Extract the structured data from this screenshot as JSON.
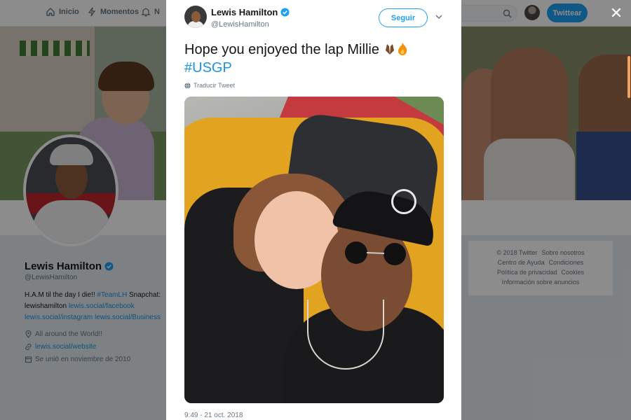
{
  "nav": {
    "home_label": "Inicio",
    "moments_label": "Momentos",
    "notifications_label": "N",
    "tweet_button_label": "Twittear"
  },
  "profile": {
    "name": "Lewis Hamilton",
    "handle": "@LewisHamilton",
    "bio_text": "H.A.M til the day I die!! ",
    "bio_tag": "#TeamLH",
    "bio_snapchat": " Snapchat: lewishamilton ",
    "bio_link1": "lewis.social/facebook",
    "bio_link2": "lewis.social/instagram",
    "bio_link3": "lewis.social/Business",
    "location": "All around the World!!",
    "website": "lewis.social/website",
    "joined": "Se unió en noviembre de 2010"
  },
  "footer": {
    "copyright": "© 2018 Twitter",
    "about": "Sobre nosotros",
    "help": "Centro de Ayuda",
    "terms": "Condiciones",
    "privacy": "Política de privacidad",
    "cookies": "Cookies",
    "ads": "Información sobre anuncios"
  },
  "tweet": {
    "author_name": "Lewis Hamilton",
    "author_handle": "@LewisHamilton",
    "follow_label": "Seguir",
    "text": "Hope you enjoyed the lap Millie",
    "hashtag": "#USGP",
    "translate_label": "Traducir Tweet",
    "timestamp": "9:49 - 21 oct. 2018"
  },
  "colors": {
    "brand_blue": "#1da1f2",
    "link_blue": "#1b95e0",
    "muted": "#657786"
  },
  "icons": [
    "home-icon",
    "bolt-icon",
    "bell-icon",
    "search-icon",
    "verified-icon",
    "chevron-down-icon",
    "globe-icon",
    "location-icon",
    "link-icon",
    "calendar-icon",
    "close-icon"
  ]
}
